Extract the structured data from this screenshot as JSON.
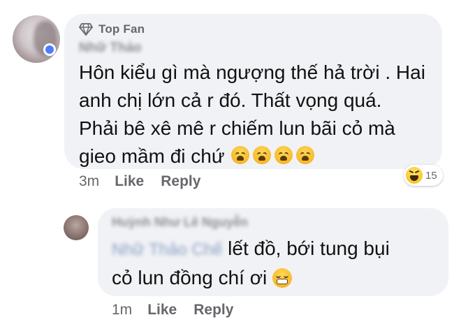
{
  "comment1": {
    "badge": "Top Fan",
    "author_name_blurred": "Nhữ Thảo",
    "text": "Hôn kiểu gì mà ngượng thế hả trời . Hai\nanh chị lớn cả r đó. Thất vọng quá.\nPhải bê xê mê r chiếm lun bãi cỏ mà\ngieo mầm đi chứ",
    "emojis": [
      "weary-face",
      "weary-face",
      "weary-face",
      "weary-face"
    ],
    "time": "3m",
    "like_label": "Like",
    "reply_label": "Reply",
    "reaction_count": "15",
    "reaction_icon": "haha-reaction-icon"
  },
  "reply1": {
    "author_name_blurred": "Huỳnh Như Lê Nguyễn",
    "mention_blurred": "Nhữ Thảo Chế",
    "text_line1": "lết đồ, bới tung bụi",
    "text_line2": "cỏ lun đồng chí ơi",
    "emoji": "grimacing-face",
    "time": "1m",
    "like_label": "Like",
    "reply_label": "Reply"
  },
  "colors": {
    "bubble": "#f0f2f5",
    "meta_text": "#65676b",
    "online": "#4f7cff"
  }
}
